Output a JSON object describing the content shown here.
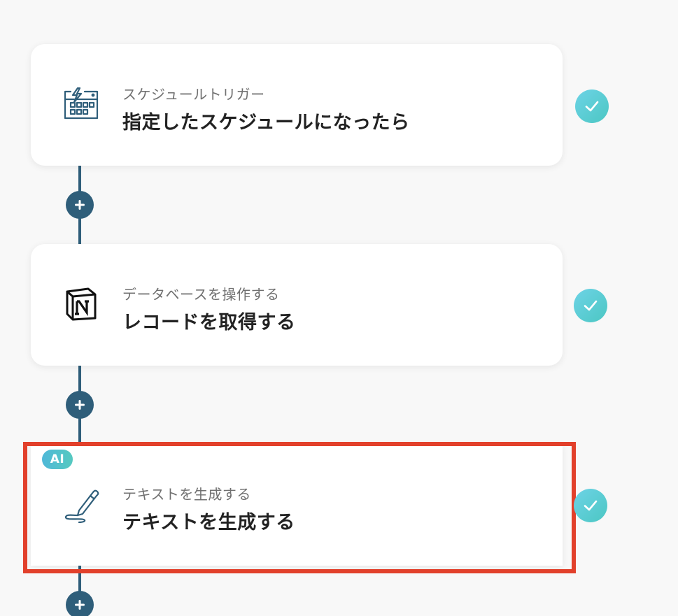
{
  "flow": {
    "steps": [
      {
        "subtitle": "スケジュールトリガー",
        "title": "指定したスケジュールになったら",
        "icon": "schedule-calendar-icon",
        "status": "completed"
      },
      {
        "subtitle": "データベースを操作する",
        "title": "レコードを取得する",
        "icon": "notion-icon",
        "status": "completed"
      },
      {
        "subtitle": "テキストを生成する",
        "title": "テキストを生成する",
        "icon": "pen-icon",
        "badge": "AI",
        "status": "completed",
        "highlighted": true
      }
    ]
  },
  "colors": {
    "connector": "#2f5e7a",
    "check_badge": "#4cc7c3",
    "highlight": "#e2402b",
    "ai_badge": "#4fb8d8"
  }
}
